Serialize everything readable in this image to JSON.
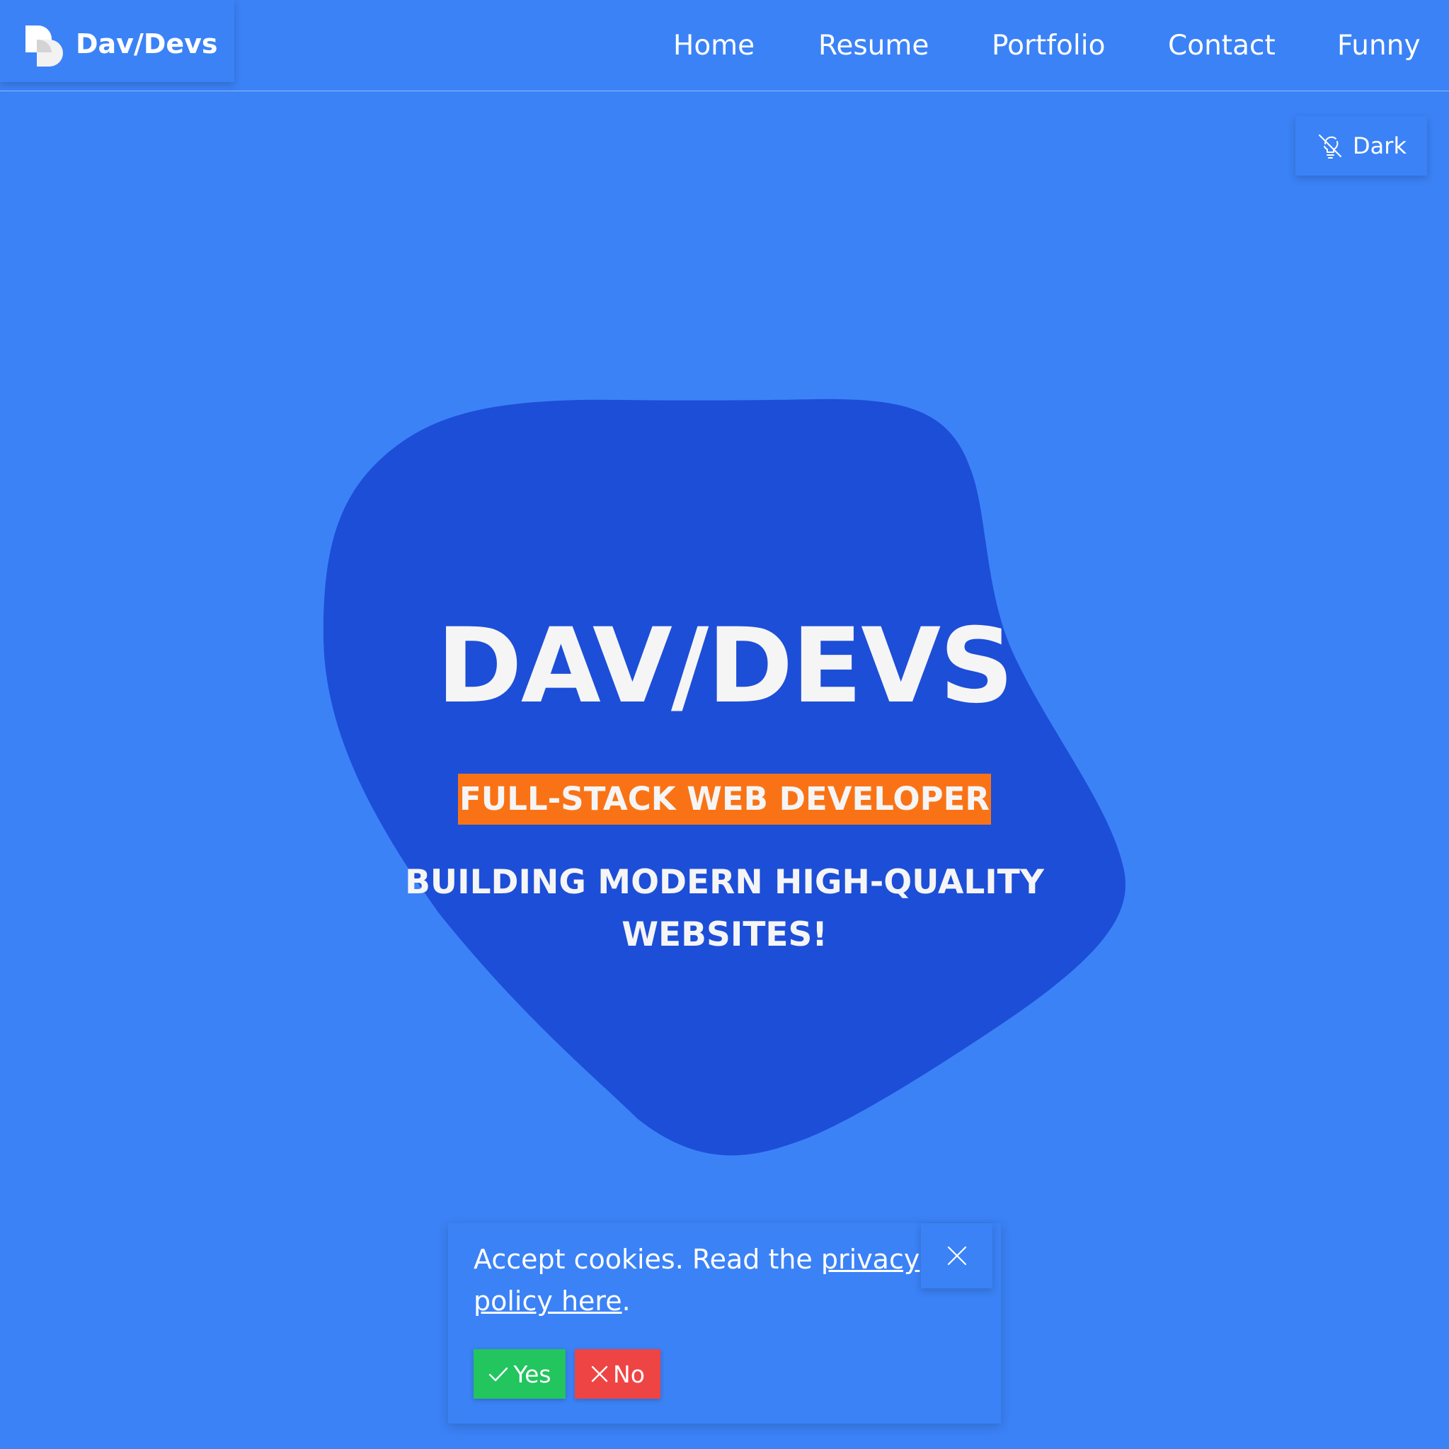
{
  "header": {
    "brand_name": "Dav/Devs",
    "nav": [
      "Home",
      "Resume",
      "Portfolio",
      "Contact",
      "Funny"
    ]
  },
  "theme_toggle": {
    "label": "Dark",
    "icon": "lightbulb-off-icon"
  },
  "hero": {
    "title": "DAV/DEVS",
    "tagline": "FULL-STACK WEB DEVELOPER",
    "subtitle_line1": "BUILDING MODERN HIGH-QUALITY",
    "subtitle_line2": "WEBSITES!"
  },
  "cookie_banner": {
    "text_before": "Accept cookies. Read the ",
    "link_text": "privacy policy here",
    "text_after": ".",
    "yes_label": "Yes",
    "no_label": "No",
    "close_icon": "close-icon"
  },
  "colors": {
    "background": "#3b82f6",
    "blob": "#1d4ed8",
    "tagline_bg": "#f97316",
    "yes_button": "#22c55e",
    "no_button": "#ef4444"
  }
}
